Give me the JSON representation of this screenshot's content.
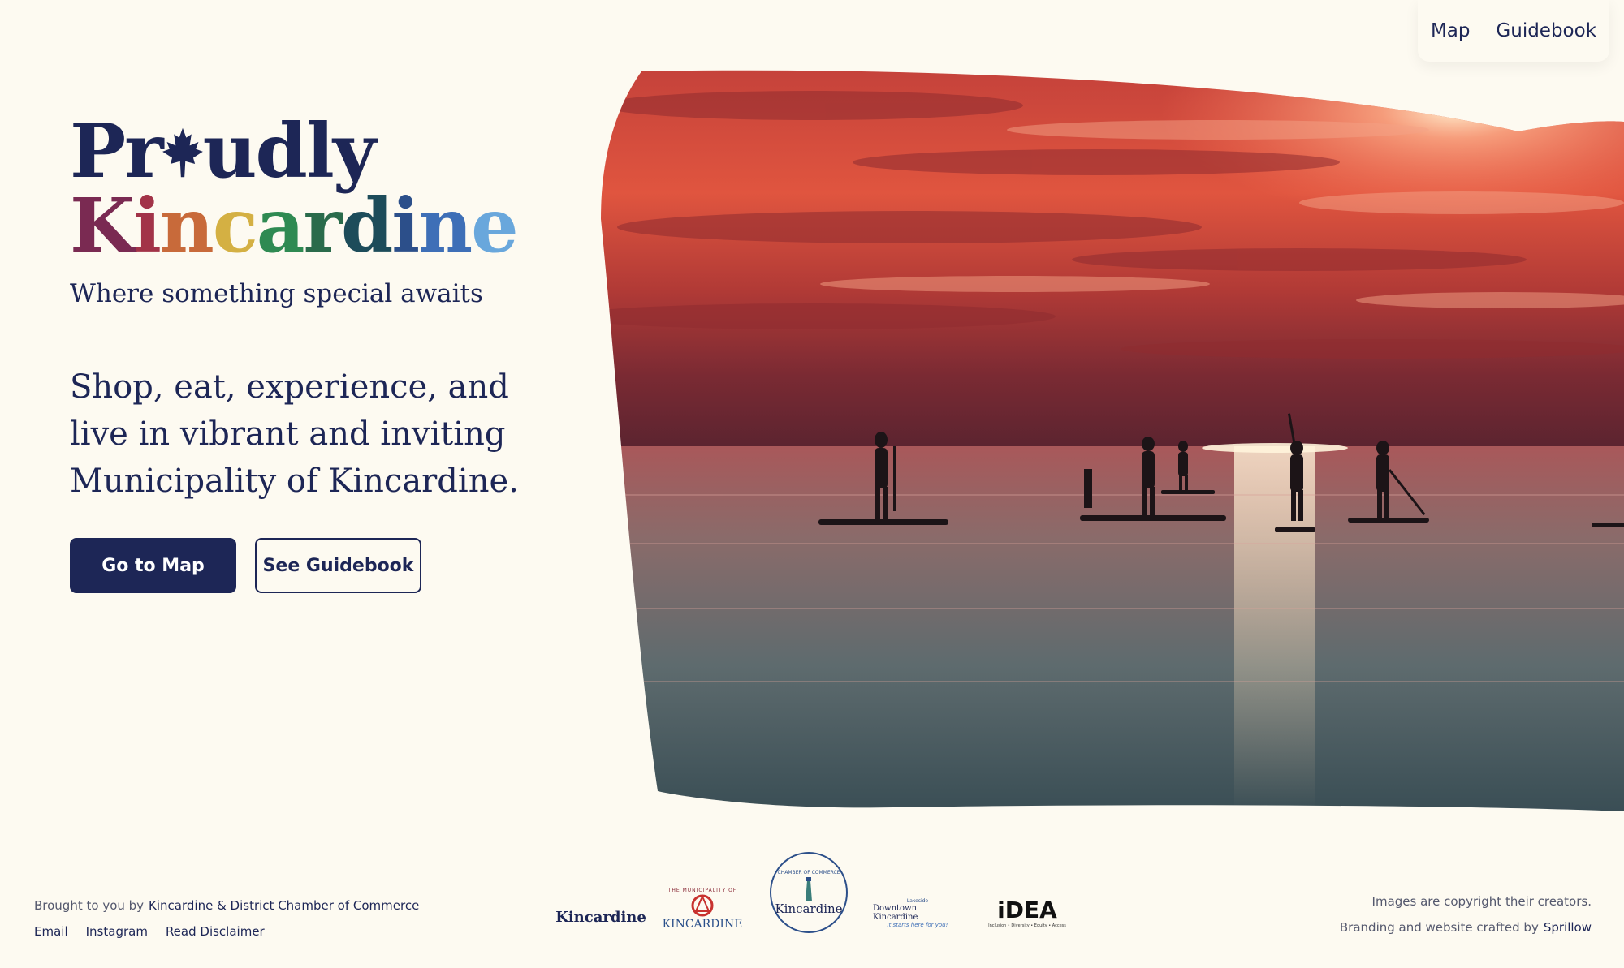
{
  "nav": {
    "map_label": "Map",
    "guidebook_label": "Guidebook"
  },
  "hero": {
    "title_line1_part1": "Pr",
    "title_line1_part2": "udly",
    "title_line2_letters": [
      "K",
      "i",
      "n",
      "c",
      "a",
      "r",
      "d",
      "i",
      "n",
      "e"
    ],
    "tagline": "Where something special awaits",
    "description": "Shop, eat, experience, and live in vibrant and inviting Municipality of Kincardine.",
    "primary_button": "Go to Map",
    "secondary_button": "See Guidebook"
  },
  "colors": {
    "navy": "#1d2656",
    "background": "#fdfaf1",
    "rainbow": [
      "#7a2a52",
      "#a23348",
      "#c86a3a",
      "#d4b043",
      "#2f8a52",
      "#2a6b4b",
      "#1d4c5a",
      "#2c4f8a",
      "#3e6fb7",
      "#69a7dc"
    ]
  },
  "footer": {
    "brought_prefix": "Brought to you by",
    "chamber_link": "Kincardine & District Chamber of Commerce",
    "email": "Email",
    "instagram": "Instagram",
    "disclaimer": "Read Disclaimer",
    "copyright": "Images are copyright their creators.",
    "crafted_prefix": "Branding and website crafted by",
    "crafted_link": "Sprillow"
  },
  "logos": {
    "kincardine": "Kincardine",
    "municipality_top": "THE MUNICIPALITY OF",
    "municipality": "KINCARDINE",
    "chamber_ring": "CHAMBER OF COMMERCE",
    "chamber_name": "Kincardine",
    "downtown_small": "Lakeside",
    "downtown": "Downtown Kincardine",
    "downtown_tag": "It starts here for you!",
    "idea": "iDEA",
    "idea_sub": "Inclusion • Diversity • Equity • Access"
  }
}
